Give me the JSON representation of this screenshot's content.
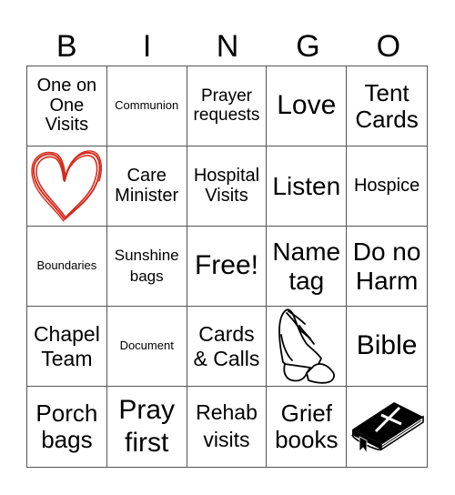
{
  "header": {
    "letters": [
      "B",
      "I",
      "N",
      "G",
      "O"
    ]
  },
  "colors": {
    "heart": "#d42b1e",
    "grid_line": "#555555"
  },
  "cells": [
    {
      "text": "One on One Visits"
    },
    {
      "text": "Communion"
    },
    {
      "text": "Prayer requests"
    },
    {
      "text": "Love"
    },
    {
      "text": "Tent Cards"
    },
    {
      "icon": "heart-icon"
    },
    {
      "text": "Care Minister"
    },
    {
      "text": "Hospital Visits"
    },
    {
      "text": "Listen"
    },
    {
      "text": "Hospice"
    },
    {
      "text": "Boundaries"
    },
    {
      "text": "Sunshine bags"
    },
    {
      "text": "Free!"
    },
    {
      "text": "Name tag"
    },
    {
      "text": "Do no Harm"
    },
    {
      "text": "Chapel Team"
    },
    {
      "text": "Document"
    },
    {
      "text": "Cards & Calls"
    },
    {
      "icon": "praying-hands-icon"
    },
    {
      "text": "Bible"
    },
    {
      "text": "Porch bags"
    },
    {
      "text": "Pray first"
    },
    {
      "text": "Rehab visits"
    },
    {
      "text": "Grief books"
    },
    {
      "icon": "bible-icon"
    }
  ]
}
